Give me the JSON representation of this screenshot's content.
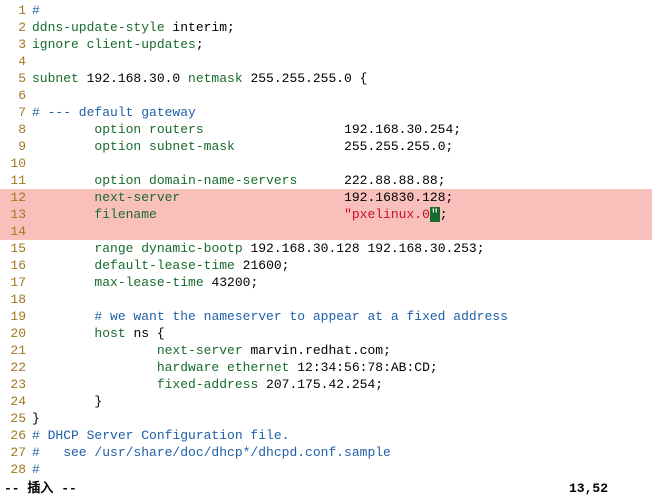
{
  "lines": [
    {
      "num": "1",
      "hl": false,
      "segs": [
        {
          "cls": "comment",
          "t": "#"
        }
      ]
    },
    {
      "num": "2",
      "hl": false,
      "segs": [
        {
          "cls": "keyword",
          "t": "ddns-update-style"
        },
        {
          "cls": "",
          "t": " interim;"
        }
      ]
    },
    {
      "num": "3",
      "hl": false,
      "segs": [
        {
          "cls": "keyword",
          "t": "ignore client-updates"
        },
        {
          "cls": "",
          "t": ";"
        }
      ]
    },
    {
      "num": "4",
      "hl": false,
      "segs": []
    },
    {
      "num": "5",
      "hl": false,
      "segs": [
        {
          "cls": "keyword",
          "t": "subnet"
        },
        {
          "cls": "",
          "t": " 192.168.30.0 "
        },
        {
          "cls": "keyword",
          "t": "netmask"
        },
        {
          "cls": "",
          "t": " 255.255.255.0 {"
        }
      ]
    },
    {
      "num": "6",
      "hl": false,
      "segs": []
    },
    {
      "num": "7",
      "hl": false,
      "segs": [
        {
          "cls": "comment",
          "t": "# --- default gateway"
        }
      ]
    },
    {
      "num": "8",
      "hl": false,
      "segs": [
        {
          "cls": "",
          "t": "        "
        },
        {
          "cls": "keyword",
          "t": "option routers"
        },
        {
          "cls": "",
          "t": "                  192.168.30.254;"
        }
      ]
    },
    {
      "num": "9",
      "hl": false,
      "segs": [
        {
          "cls": "",
          "t": "        "
        },
        {
          "cls": "keyword",
          "t": "option subnet-mask"
        },
        {
          "cls": "",
          "t": "              255.255.255.0;"
        }
      ]
    },
    {
      "num": "10",
      "hl": false,
      "segs": []
    },
    {
      "num": "11",
      "hl": false,
      "segs": [
        {
          "cls": "",
          "t": "        "
        },
        {
          "cls": "keyword",
          "t": "option domain-name-servers"
        },
        {
          "cls": "",
          "t": "      222.88.88.88;"
        }
      ]
    },
    {
      "num": "12",
      "hl": true,
      "segs": [
        {
          "cls": "",
          "t": "        "
        },
        {
          "cls": "keyword",
          "t": "next-server"
        },
        {
          "cls": "",
          "t": "                     192.16830.128;"
        }
      ]
    },
    {
      "num": "13",
      "hl": true,
      "segs": [
        {
          "cls": "",
          "t": "        "
        },
        {
          "cls": "keyword",
          "t": "filename"
        },
        {
          "cls": "",
          "t": "                        "
        },
        {
          "cls": "string",
          "t": "\"pxelinux.0"
        },
        {
          "cls": "caret",
          "t": "\""
        },
        {
          "cls": "",
          "t": ";"
        }
      ]
    },
    {
      "num": "14",
      "hl": true,
      "segs": []
    },
    {
      "num": "15",
      "hl": false,
      "segs": [
        {
          "cls": "",
          "t": "        "
        },
        {
          "cls": "keyword",
          "t": "range dynamic-bootp"
        },
        {
          "cls": "",
          "t": " 192.168.30.128 192.168.30.253;"
        }
      ]
    },
    {
      "num": "16",
      "hl": false,
      "segs": [
        {
          "cls": "",
          "t": "        "
        },
        {
          "cls": "keyword",
          "t": "default-lease-time"
        },
        {
          "cls": "",
          "t": " 21600;"
        }
      ]
    },
    {
      "num": "17",
      "hl": false,
      "segs": [
        {
          "cls": "",
          "t": "        "
        },
        {
          "cls": "keyword",
          "t": "max-lease-time"
        },
        {
          "cls": "",
          "t": " 43200;"
        }
      ]
    },
    {
      "num": "18",
      "hl": false,
      "segs": []
    },
    {
      "num": "19",
      "hl": false,
      "segs": [
        {
          "cls": "",
          "t": "        "
        },
        {
          "cls": "comment",
          "t": "# we want the nameserver to appear at a fixed address"
        }
      ]
    },
    {
      "num": "20",
      "hl": false,
      "segs": [
        {
          "cls": "",
          "t": "        "
        },
        {
          "cls": "keyword",
          "t": "host"
        },
        {
          "cls": "",
          "t": " ns {"
        }
      ]
    },
    {
      "num": "21",
      "hl": false,
      "segs": [
        {
          "cls": "",
          "t": "                "
        },
        {
          "cls": "keyword",
          "t": "next-server"
        },
        {
          "cls": "",
          "t": " marvin.redhat.com;"
        }
      ]
    },
    {
      "num": "22",
      "hl": false,
      "segs": [
        {
          "cls": "",
          "t": "                "
        },
        {
          "cls": "keyword",
          "t": "hardware ethernet"
        },
        {
          "cls": "",
          "t": " 12:34:56:78:AB:CD;"
        }
      ]
    },
    {
      "num": "23",
      "hl": false,
      "segs": [
        {
          "cls": "",
          "t": "                "
        },
        {
          "cls": "keyword",
          "t": "fixed-address"
        },
        {
          "cls": "",
          "t": " 207.175.42.254;"
        }
      ]
    },
    {
      "num": "24",
      "hl": false,
      "segs": [
        {
          "cls": "",
          "t": "        }"
        }
      ]
    },
    {
      "num": "25",
      "hl": false,
      "segs": [
        {
          "cls": "",
          "t": "}"
        }
      ]
    },
    {
      "num": "26",
      "hl": false,
      "segs": [
        {
          "cls": "comment",
          "t": "# DHCP Server Configuration file."
        }
      ]
    },
    {
      "num": "27",
      "hl": false,
      "segs": [
        {
          "cls": "comment",
          "t": "#   see /usr/share/doc/dhcp*/dhcpd.conf.sample"
        }
      ]
    },
    {
      "num": "28",
      "hl": false,
      "segs": [
        {
          "cls": "comment",
          "t": "#"
        }
      ]
    }
  ],
  "status": {
    "mode": "-- 插入 --",
    "position": "13,52"
  }
}
